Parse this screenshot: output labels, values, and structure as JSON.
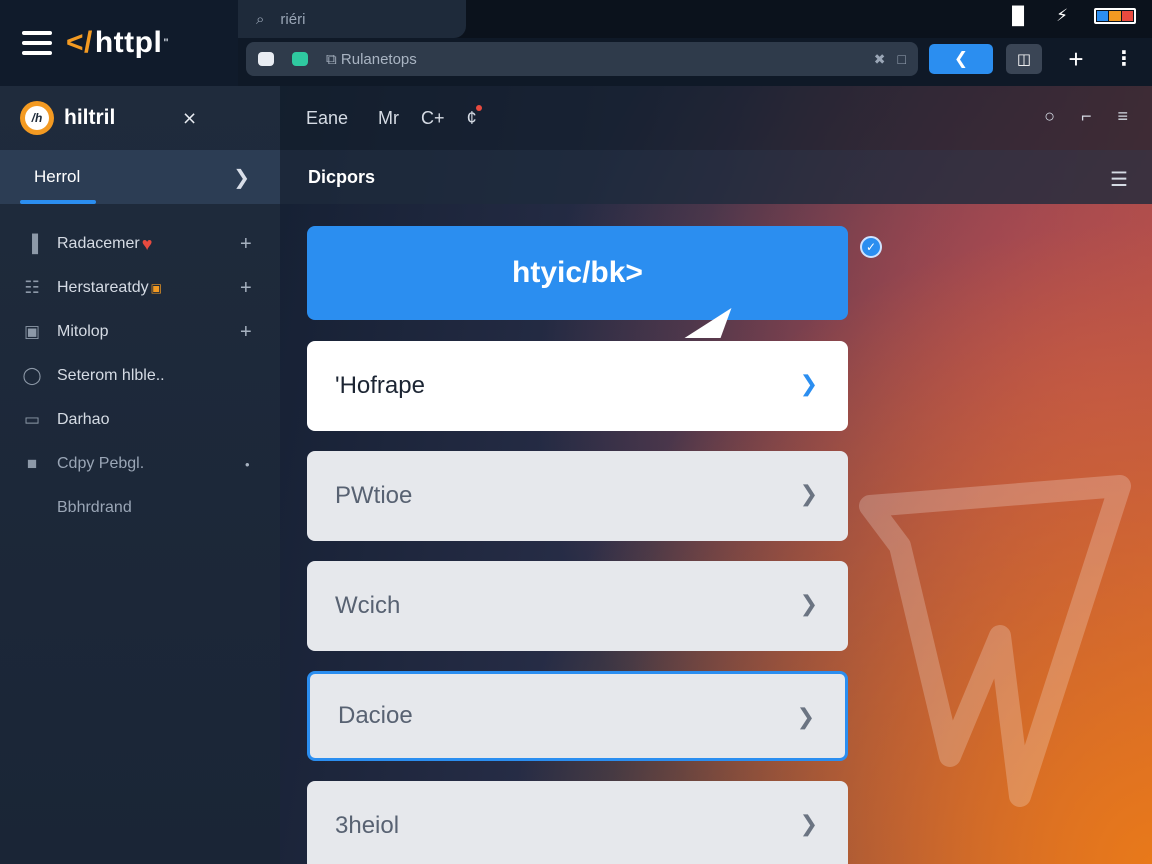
{
  "brand": {
    "name": "httpl",
    "mark": "</",
    "suffix": "\""
  },
  "tab": {
    "label": "riéri"
  },
  "address": {
    "text": "Rulanetops"
  },
  "colors": {
    "accent": "#2b8ef0",
    "brand_orange": "#f39a22",
    "heart_red": "#e84a3f",
    "sidebar_bg": "#1f2b3c",
    "topbar_bg": "#0f1927"
  },
  "sidebar": {
    "title": "hiltril",
    "crumb": "Herrol",
    "items": [
      {
        "label": "Radacemer",
        "icon": "chart-icon",
        "badge": "heart",
        "action": "+"
      },
      {
        "label": "Herstareatdy",
        "icon": "sliders-icon",
        "badge": "dot",
        "action": "+"
      },
      {
        "label": "Mitolop",
        "icon": "window-icon",
        "action": "+"
      },
      {
        "label": "Seterom hlble..",
        "icon": "search-icon"
      },
      {
        "label": "Darhao",
        "icon": "monitor-icon"
      },
      {
        "label": "Cdpy Pebgl.",
        "icon": "file-icon",
        "action": "•"
      },
      {
        "label": "Bbhrdrand"
      }
    ]
  },
  "main": {
    "toolbar": [
      "Eane",
      "Mr",
      "C+",
      "¢"
    ],
    "subtitle": "Dicpors",
    "hero_label": "htyic/bk>",
    "cards": [
      {
        "label": "'Hofrape",
        "style": "white"
      },
      {
        "label": "PWtioe",
        "style": "grey"
      },
      {
        "label": "Wcich",
        "style": "grey"
      },
      {
        "label": "Dacioe",
        "style": "selected"
      },
      {
        "label": "3heiol",
        "style": "grey"
      }
    ]
  }
}
